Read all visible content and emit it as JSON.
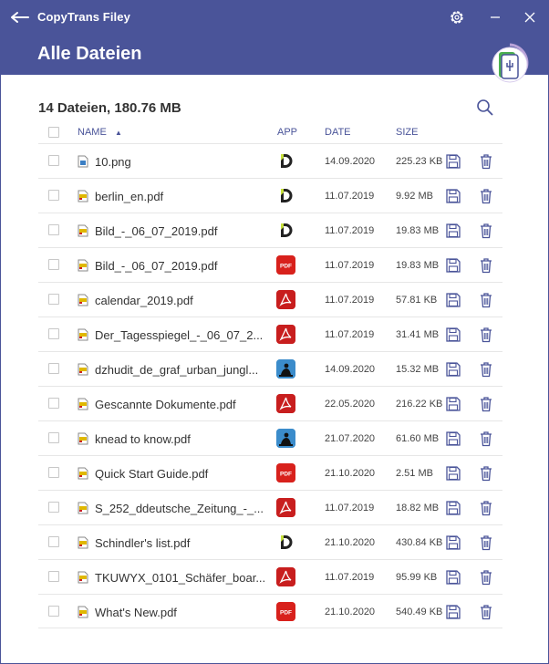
{
  "window": {
    "app_title": "CopyTrans Filey",
    "page_title": "Alle Dateien"
  },
  "summary": "14 Dateien, 180.76 MB",
  "columns": {
    "name": "NAME",
    "app": "APP",
    "date": "DATE",
    "size": "SIZE"
  },
  "sort_indicator": "▲",
  "colors": {
    "titlebar": "#4a5499",
    "accent": "#4a5499"
  },
  "files": [
    {
      "name": "10.png",
      "file_icon": "image-file-icon",
      "app": "documents-app-icon",
      "date": "14.09.2020",
      "size": "225.23 KB"
    },
    {
      "name": "berlin_en.pdf",
      "file_icon": "pdf-file-icon",
      "app": "documents-app-icon",
      "date": "11.07.2019",
      "size": "9.92 MB"
    },
    {
      "name": "Bild_-_06_07_2019.pdf",
      "file_icon": "pdf-file-icon",
      "app": "documents-app-icon",
      "date": "11.07.2019",
      "size": "19.83 MB"
    },
    {
      "name": "Bild_-_06_07_2019.pdf",
      "file_icon": "pdf-file-icon",
      "app": "pdf-expert-app-icon",
      "date": "11.07.2019",
      "size": "19.83 MB"
    },
    {
      "name": "calendar_2019.pdf",
      "file_icon": "pdf-file-icon",
      "app": "adobe-acrobat-app-icon",
      "date": "11.07.2019",
      "size": "57.81 KB"
    },
    {
      "name": "Der_Tagesspiegel_-_06_07_2...",
      "file_icon": "pdf-file-icon",
      "app": "adobe-acrobat-app-icon",
      "date": "11.07.2019",
      "size": "31.41 MB"
    },
    {
      "name": "dzhudit_de_graf_urban_jungl...",
      "file_icon": "pdf-file-icon",
      "app": "kindle-app-icon",
      "date": "14.09.2020",
      "size": "15.32 MB"
    },
    {
      "name": "Gescannte Dokumente.pdf",
      "file_icon": "pdf-file-icon",
      "app": "adobe-acrobat-app-icon",
      "date": "22.05.2020",
      "size": "216.22 KB"
    },
    {
      "name": "knead to know.pdf",
      "file_icon": "pdf-file-icon",
      "app": "kindle-app-icon",
      "date": "21.07.2020",
      "size": "61.60 MB"
    },
    {
      "name": "Quick Start Guide.pdf",
      "file_icon": "pdf-file-icon",
      "app": "pdf-expert-app-icon",
      "date": "21.10.2020",
      "size": "2.51 MB"
    },
    {
      "name": "S_252_ddeutsche_Zeitung_-_...",
      "file_icon": "pdf-file-icon",
      "app": "adobe-acrobat-app-icon",
      "date": "11.07.2019",
      "size": "18.82 MB"
    },
    {
      "name": "Schindler's list.pdf",
      "file_icon": "pdf-file-icon",
      "app": "documents-app-icon",
      "date": "21.10.2020",
      "size": "430.84 KB"
    },
    {
      "name": "TKUWYX_0101_Schäfer_boar...",
      "file_icon": "pdf-file-icon",
      "app": "adobe-acrobat-app-icon",
      "date": "11.07.2019",
      "size": "95.99 KB"
    },
    {
      "name": "What's New.pdf",
      "file_icon": "pdf-file-icon",
      "app": "pdf-expert-app-icon",
      "date": "21.10.2020",
      "size": "540.49 KB"
    }
  ]
}
